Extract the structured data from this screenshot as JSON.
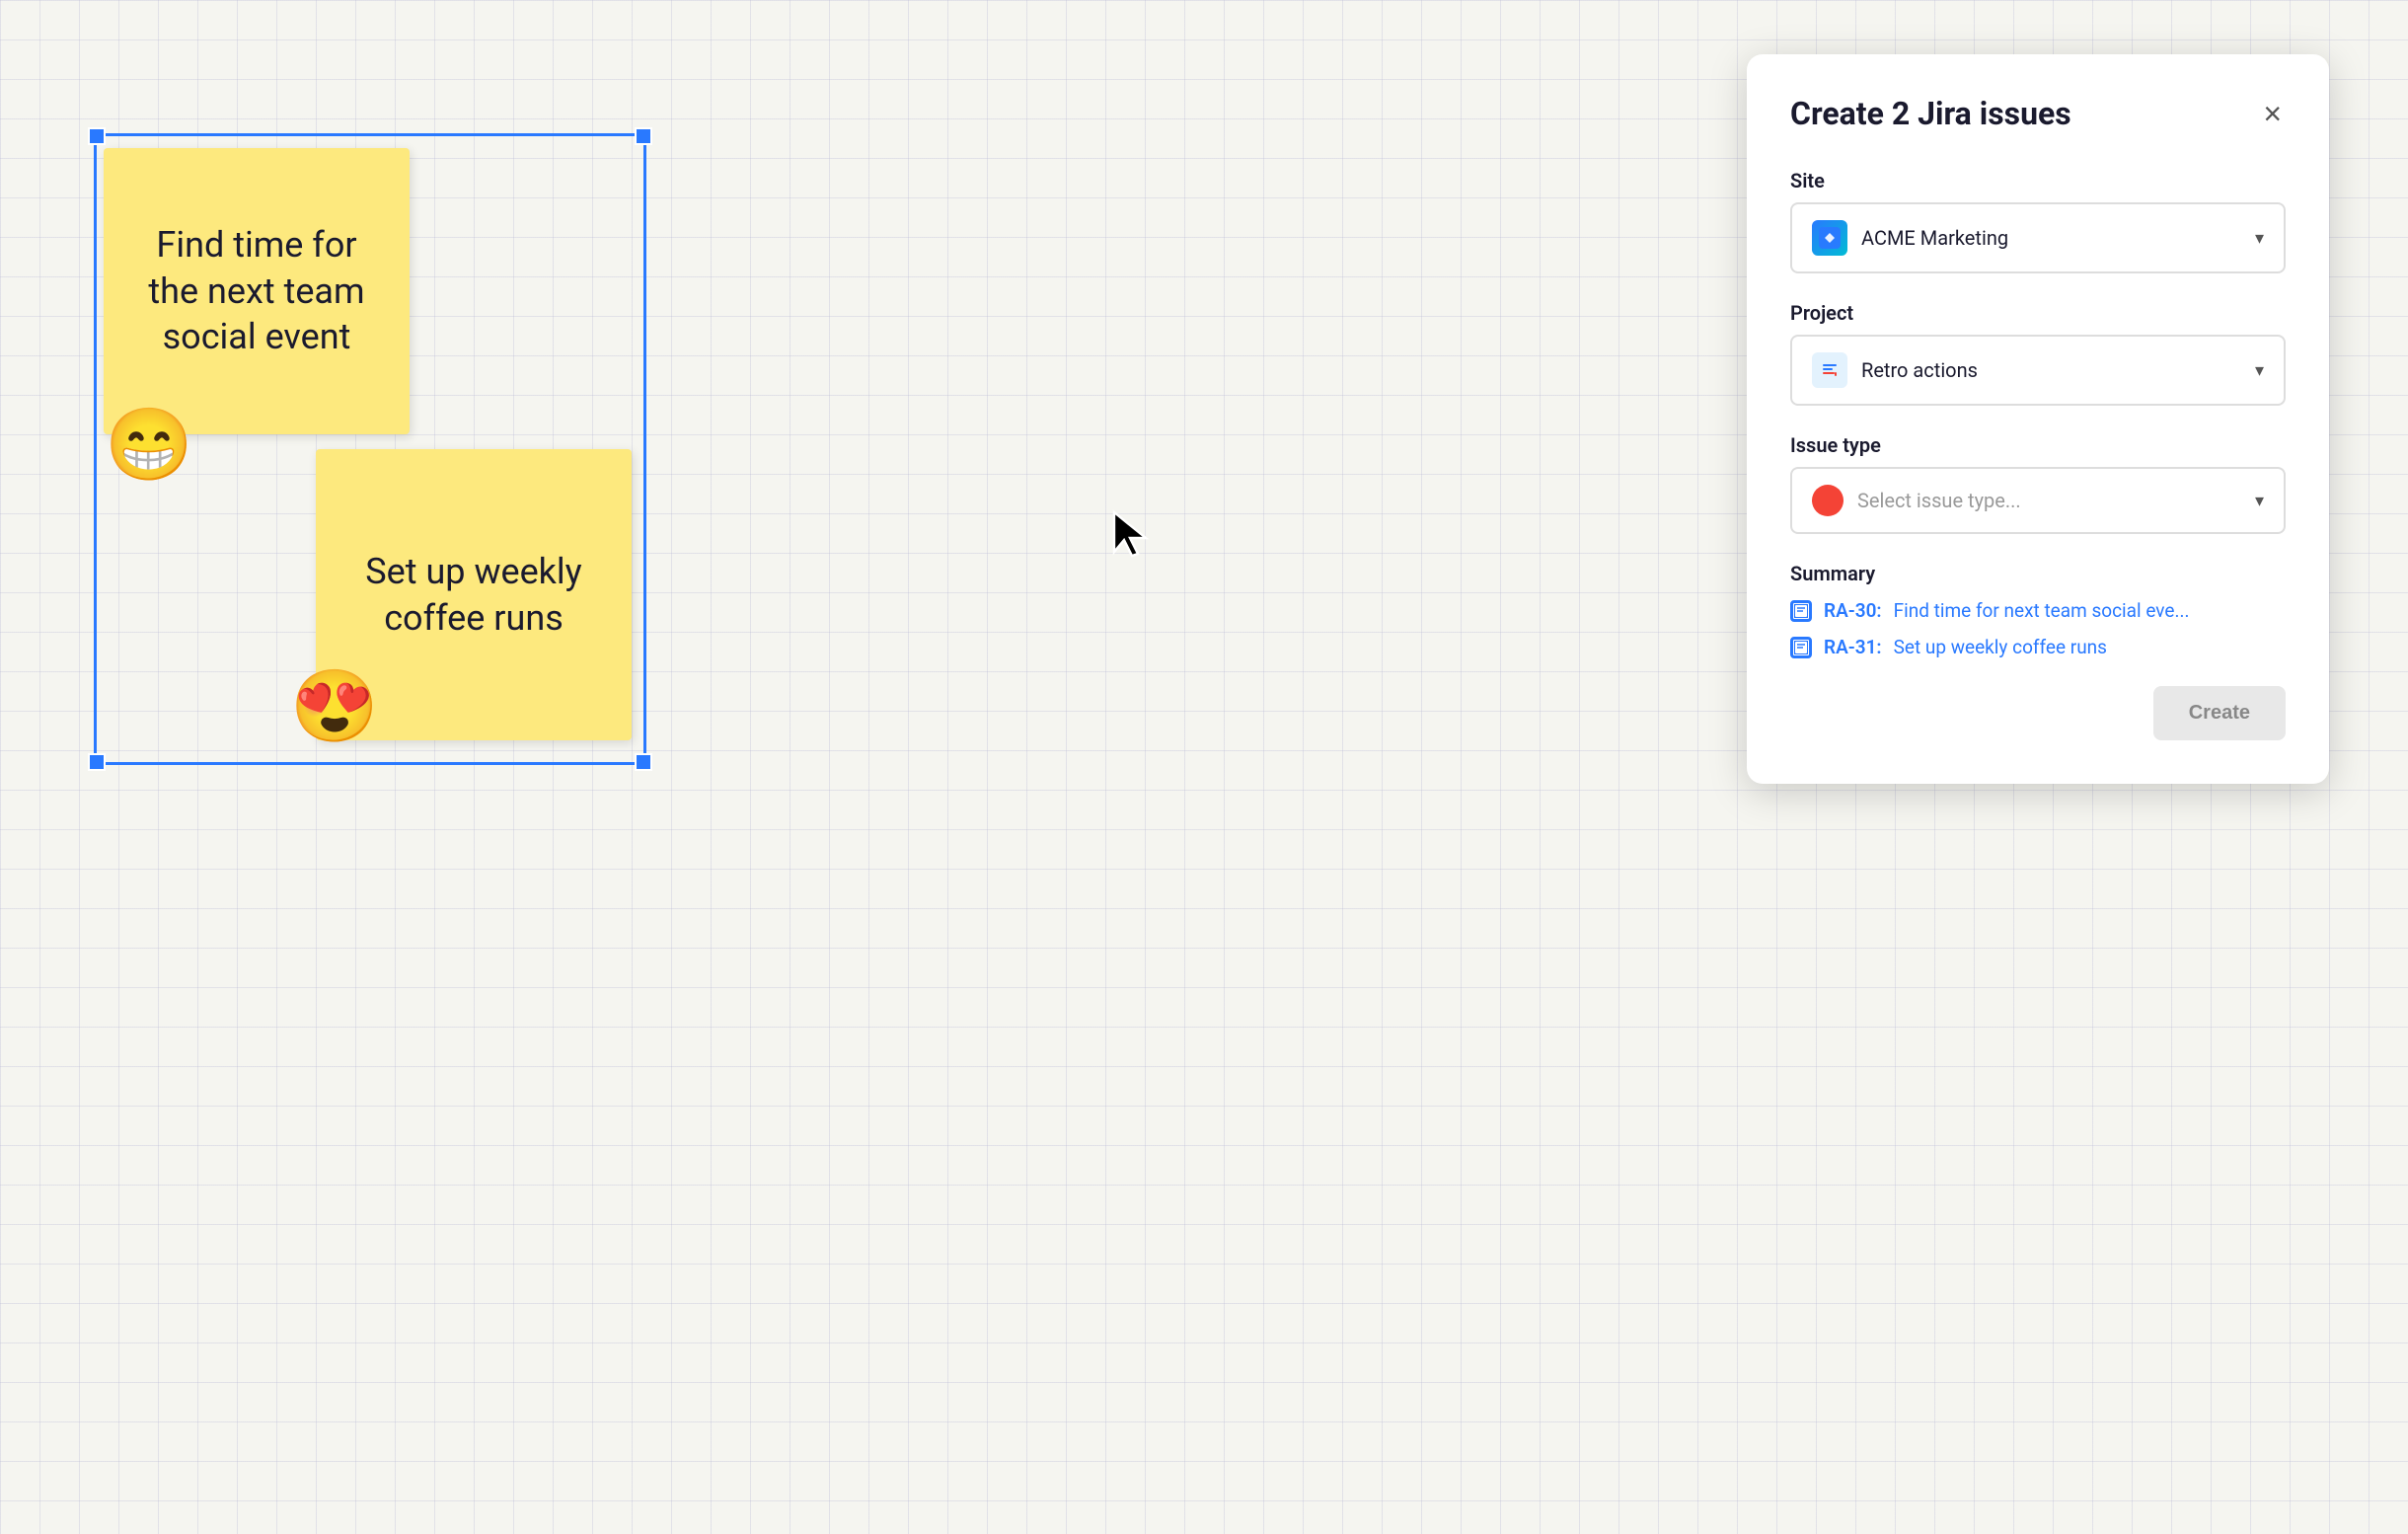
{
  "canvas": {
    "sticky1": {
      "text": "Find time for the next team social event"
    },
    "sticky2": {
      "text": "Set up weekly coffee runs"
    },
    "emoji1": "😁",
    "emoji2": "😍"
  },
  "dialog": {
    "title": "Create 2 Jira issues",
    "close_label": "×",
    "site_label": "Site",
    "site_value": "ACME Marketing",
    "site_icon": "✦",
    "project_label": "Project",
    "project_value": "Retro actions",
    "project_icon": "📋",
    "issue_type_label": "Issue type",
    "issue_type_placeholder": "Select issue type...",
    "summary_label": "Summary",
    "summary_items": [
      {
        "key": "RA-30",
        "text": "Find time for next team social eve..."
      },
      {
        "key": "RA-31",
        "text": "Set up weekly coffee runs"
      }
    ],
    "create_label": "Create"
  }
}
